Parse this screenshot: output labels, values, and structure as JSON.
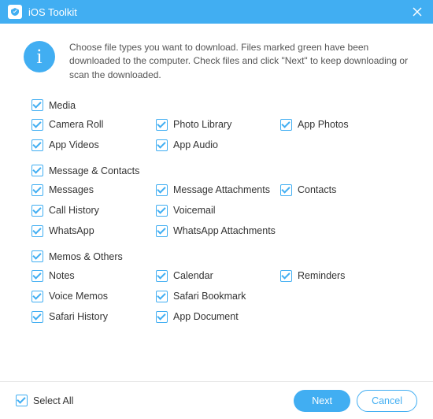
{
  "titlebar": {
    "title": "iOS Toolkit"
  },
  "info": {
    "text": "Choose file types you want to download. Files marked green have been downloaded to the computer. Check files and click \"Next\" to keep downloading or scan the downloaded."
  },
  "groups": [
    {
      "header": "Media",
      "items": [
        {
          "label": "Camera Roll",
          "checked": true
        },
        {
          "label": "Photo Library",
          "checked": true
        },
        {
          "label": "App Photos",
          "checked": true
        },
        {
          "label": "App Videos",
          "checked": true
        },
        {
          "label": "App Audio",
          "checked": true
        }
      ]
    },
    {
      "header": "Message & Contacts",
      "items": [
        {
          "label": "Messages",
          "checked": true
        },
        {
          "label": "Message Attachments",
          "checked": true
        },
        {
          "label": "Contacts",
          "checked": true
        },
        {
          "label": "Call History",
          "checked": true
        },
        {
          "label": "Voicemail",
          "checked": true
        },
        {
          "label": "",
          "checked": false,
          "empty": true
        },
        {
          "label": "WhatsApp",
          "checked": true
        },
        {
          "label": "WhatsApp Attachments",
          "checked": true
        }
      ]
    },
    {
      "header": "Memos & Others",
      "items": [
        {
          "label": "Notes",
          "checked": true
        },
        {
          "label": "Calendar",
          "checked": true
        },
        {
          "label": "Reminders",
          "checked": true
        },
        {
          "label": "Voice Memos",
          "checked": true
        },
        {
          "label": "Safari Bookmark",
          "checked": true
        },
        {
          "label": "",
          "checked": false,
          "empty": true
        },
        {
          "label": "Safari History",
          "checked": true
        },
        {
          "label": "App Document",
          "checked": true
        }
      ]
    }
  ],
  "footer": {
    "select_all": {
      "label": "Select All",
      "checked": true
    },
    "next": "Next",
    "cancel": "Cancel"
  },
  "colors": {
    "accent": "#41aef2"
  }
}
